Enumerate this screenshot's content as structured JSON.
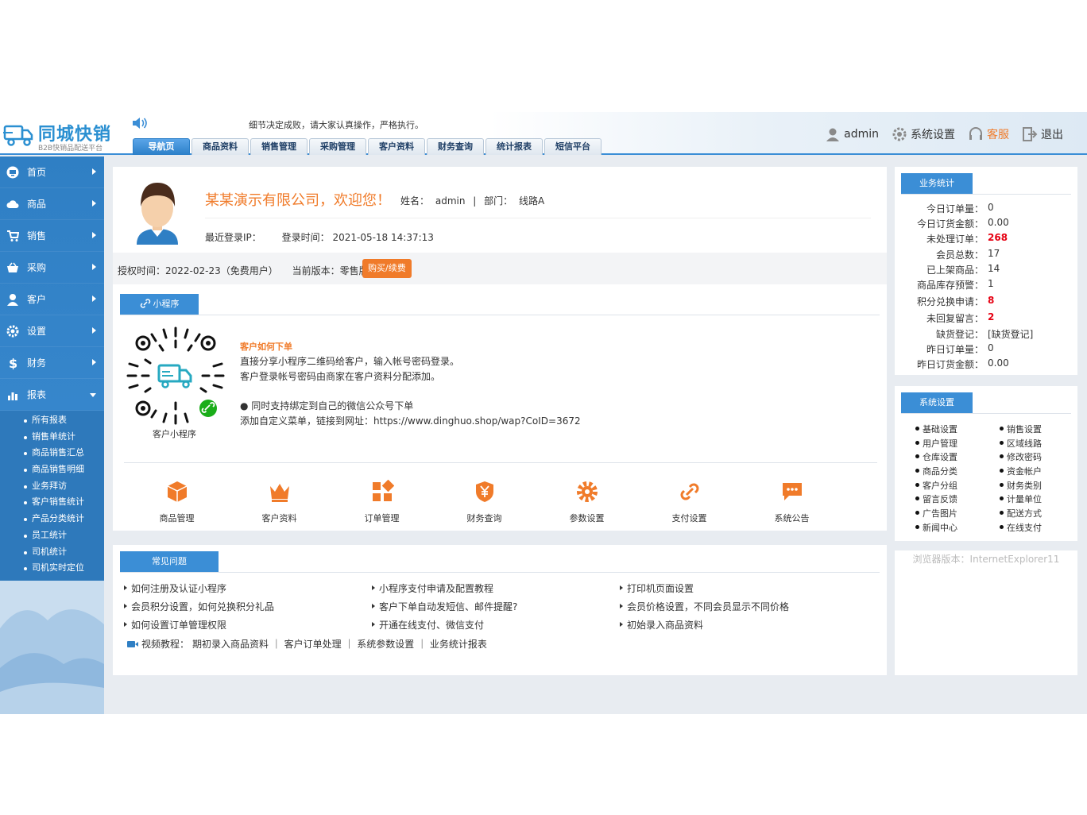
{
  "header": {
    "logo_title": "同城快销",
    "logo_subtitle": "B2B快销品配送平台",
    "marquee": "细节决定成败，请大家认真操作，严格执行。",
    "tabs": [
      {
        "label": "导航页",
        "active": true
      },
      {
        "label": "商品资料"
      },
      {
        "label": "销售管理"
      },
      {
        "label": "采购管理"
      },
      {
        "label": "客户资料"
      },
      {
        "label": "财务查询"
      },
      {
        "label": "统计报表"
      },
      {
        "label": "短信平台"
      }
    ],
    "user": "admin",
    "settings": "系统设置",
    "service": "客服",
    "logout": "退出"
  },
  "sidebar": {
    "items": [
      {
        "label": "首页",
        "icon": "monitor-icon"
      },
      {
        "label": "商品",
        "icon": "cloud-icon"
      },
      {
        "label": "销售",
        "icon": "cart-icon"
      },
      {
        "label": "采购",
        "icon": "basket-icon"
      },
      {
        "label": "客户",
        "icon": "user-icon"
      },
      {
        "label": "设置",
        "icon": "gear-icon"
      },
      {
        "label": "财务",
        "icon": "dollar-icon"
      },
      {
        "label": "报表",
        "icon": "bar-chart-icon"
      }
    ],
    "report_subitems": [
      "所有报表",
      "销售单统计",
      "商品销售汇总",
      "商品销售明细",
      "业务拜访",
      "客户销售统计",
      "产品分类统计",
      "员工统计",
      "司机统计",
      "司机实时定位"
    ]
  },
  "welcome": {
    "company": "某某演示有限公司，欢迎您！",
    "name_label": "姓名：",
    "name": "admin",
    "dept_label": "部门：",
    "dept": "线路A",
    "last_ip_label": "最近登录IP：",
    "login_time_label": "登录时间：",
    "login_time": "2021-05-18 14:37:13",
    "license_label": "授权时间：",
    "license": "2022-02-23（免费用户）",
    "version_label": "当前版本：",
    "version": "零售版",
    "buy_button": "购买/续费"
  },
  "miniprogram": {
    "tab": "小程序",
    "qr_label": "客户小程序",
    "title": "客户如何下单",
    "line1": "直接分享小程序二维码给客户，输入帐号密码登录。",
    "line2": "客户登录帐号密码由商家在客户资料分配添加。",
    "line3": "● 同时支持绑定到自己的微信公众号下单",
    "line4": "添加自定义菜单，链接到网址：https://www.dinghuo.shop/wap?CoID=3672"
  },
  "quick_links": [
    {
      "label": "商品管理",
      "icon": "box-icon"
    },
    {
      "label": "客户资料",
      "icon": "crown-icon"
    },
    {
      "label": "订单管理",
      "icon": "grid-icon"
    },
    {
      "label": "财务查询",
      "icon": "yen-shield-icon"
    },
    {
      "label": "参数设置",
      "icon": "gear-icon"
    },
    {
      "label": "支付设置",
      "icon": "link-icon"
    },
    {
      "label": "系统公告",
      "icon": "chat-icon"
    }
  ],
  "faq": {
    "tab": "常见问题",
    "items": [
      "如何注册及认证小程序",
      "小程序支付申请及配置教程",
      "打印机页面设置",
      "会员积分设置，如何兑换积分礼品",
      "客户下单自动发短信、邮件提醒?",
      "会员价格设置，不同会员显示不同价格",
      "如何设置订单管理权限",
      "开通在线支付、微信支付",
      "初始录入商品资料"
    ],
    "video_label": "视频教程：",
    "videos": "期初录入商品资料 ｜ 客户订单处理 ｜ 系统参数设置 ｜ 业务统计报表"
  },
  "stats": {
    "tab": "业务统计",
    "rows": [
      {
        "k": "今日订单量：",
        "v": "0"
      },
      {
        "k": "今日订货金额：",
        "v": "0.00"
      },
      {
        "k": "未处理订单：",
        "v": "268",
        "red": true
      },
      {
        "k": "会员总数：",
        "v": "17"
      },
      {
        "k": "已上架商品：",
        "v": "14"
      },
      {
        "k": "商品库存预警：",
        "v": "1"
      },
      {
        "k": "积分兑换申请：",
        "v": "8",
        "red": true
      },
      {
        "k": "未回复留言：",
        "v": "2",
        "red": true
      },
      {
        "k": "缺货登记：",
        "v": "[缺货登记]"
      },
      {
        "k": "昨日订单量：",
        "v": "0"
      },
      {
        "k": "昨日订货金额：",
        "v": "0.00"
      }
    ]
  },
  "system": {
    "tab": "系统设置",
    "left": [
      "基础设置",
      "用户管理",
      "仓库设置",
      "商品分类",
      "客户分组",
      "留言反馈",
      "广告图片",
      "新闻中心"
    ],
    "right": [
      "销售设置",
      "区域线路",
      "修改密码",
      "资金帐户",
      "财务类别",
      "计量单位",
      "配送方式",
      "在线支付"
    ]
  },
  "browser": "浏览器版本：InternetExplorer11",
  "colors": {
    "primary": "#3b8ed6",
    "accent": "#f07b2a",
    "alert": "#e60012"
  }
}
